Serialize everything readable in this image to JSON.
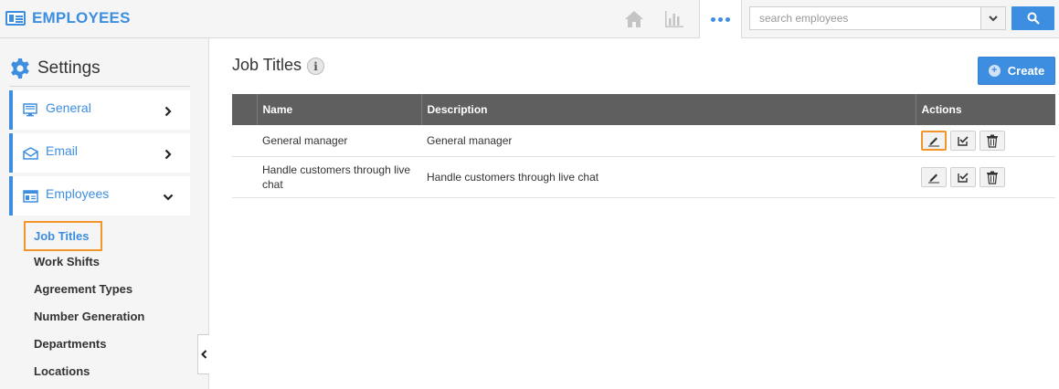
{
  "app": {
    "title": "EMPLOYEES",
    "icon": "id-card-icon"
  },
  "topbar": {
    "home_icon": "home-icon",
    "stats_icon": "bar-chart-icon",
    "more_icon": "more-dots-icon",
    "search_placeholder": "search employees",
    "search_value": ""
  },
  "sidebar": {
    "title": "Settings",
    "sections": [
      {
        "label": "General",
        "icon": "monitor-icon",
        "expanded": false
      },
      {
        "label": "Email",
        "icon": "envelope-icon",
        "expanded": false
      },
      {
        "label": "Employees",
        "icon": "id-card-icon",
        "expanded": true
      }
    ],
    "sub_items": [
      {
        "label": "Job Titles",
        "active": true
      },
      {
        "label": "Work Shifts"
      },
      {
        "label": "Agreement Types"
      },
      {
        "label": "Number Generation"
      },
      {
        "label": "Departments"
      },
      {
        "label": "Locations"
      }
    ]
  },
  "main": {
    "title": "Job Titles",
    "create_label": "Create",
    "table": {
      "columns": [
        "",
        "Name",
        "Description",
        "Actions"
      ],
      "rows": [
        {
          "name": "General manager",
          "description": "General manager"
        },
        {
          "name": "Handle customers through live chat",
          "description": "Handle customers through live chat"
        }
      ]
    }
  },
  "colors": {
    "accent": "#3d8ee0",
    "highlight": "#f0962b",
    "table_header": "#5f5f5f"
  }
}
